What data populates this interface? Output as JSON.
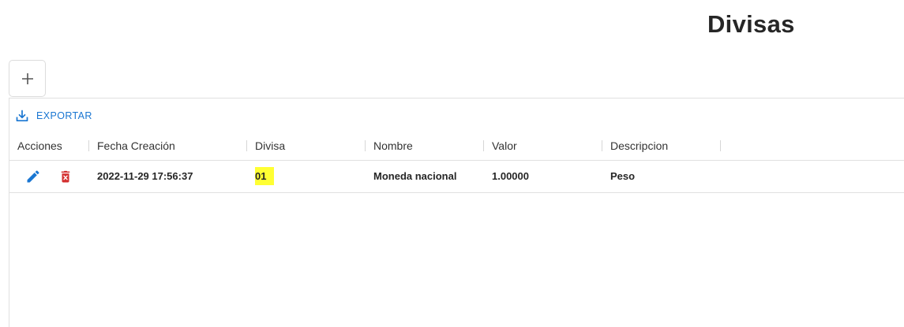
{
  "page": {
    "title": "Divisas"
  },
  "toolbar": {
    "add_icon": "plus-icon",
    "export_label": "EXPORTAR",
    "export_icon": "download-icon"
  },
  "table": {
    "columns": [
      "Acciones",
      "Fecha Creación",
      "Divisa",
      "Nombre",
      "Valor",
      "Descripcion"
    ],
    "rows": [
      {
        "actions": [
          "edit-icon",
          "delete-icon"
        ],
        "fecha_creacion": "2022-11-29 17:56:37",
        "divisa": "01",
        "nombre": "Moneda nacional",
        "valor": "1.00000",
        "descripcion": "Peso"
      }
    ]
  },
  "colors": {
    "accent": "#1976d2",
    "delete": "#d32f2f",
    "highlight": "#ffff33"
  }
}
